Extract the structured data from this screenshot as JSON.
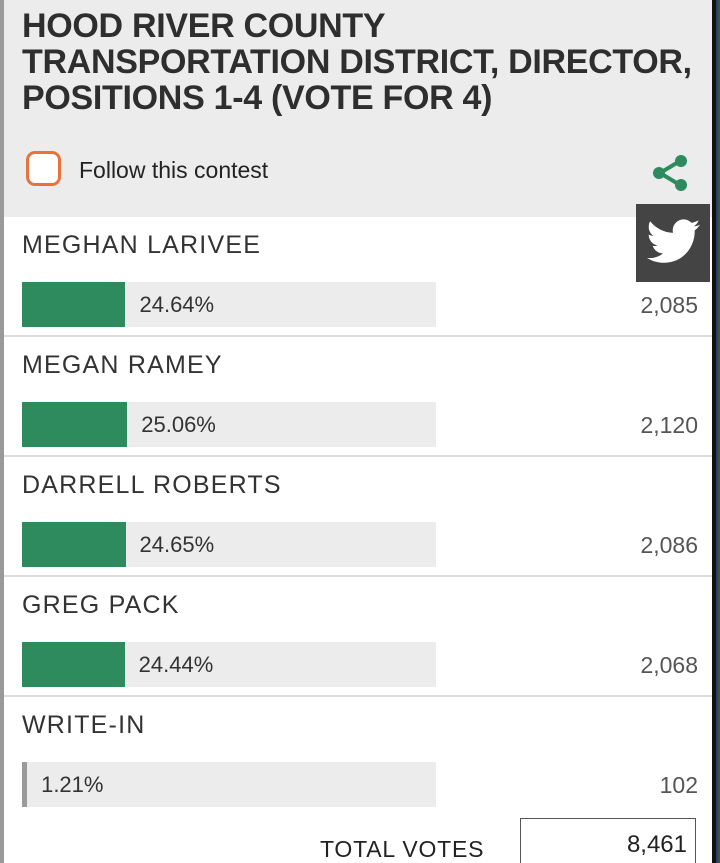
{
  "contest": {
    "title": "HOOD RIVER COUNTY TRANSPORTATION DISTRICT, DIRECTOR, POSITIONS 1-4 (VOTE FOR 4)",
    "follow_label": "Follow this contest",
    "share_icon": "share-icon",
    "twitter_icon": "twitter-bird-icon"
  },
  "colors": {
    "bar_fill": "#2e8b5e",
    "bar_track": "#ececec",
    "follow_checkbox_border": "#e8733a",
    "header_bg": "#ececec"
  },
  "candidates": [
    {
      "name": "MEGHAN LARIVEE",
      "percent_label": "24.64%",
      "percent": 24.64,
      "votes": "2,085"
    },
    {
      "name": "MEGAN RAMEY",
      "percent_label": "25.06%",
      "percent": 25.06,
      "votes": "2,120"
    },
    {
      "name": "DARRELL ROBERTS",
      "percent_label": "24.65%",
      "percent": 24.65,
      "votes": "2,086"
    },
    {
      "name": "GREG PACK",
      "percent_label": "24.44%",
      "percent": 24.44,
      "votes": "2,068"
    },
    {
      "name": "WRITE-IN",
      "percent_label": "1.21%",
      "percent": 1.21,
      "votes": "102"
    }
  ],
  "total": {
    "label": "TOTAL VOTES",
    "value": "8,461"
  }
}
